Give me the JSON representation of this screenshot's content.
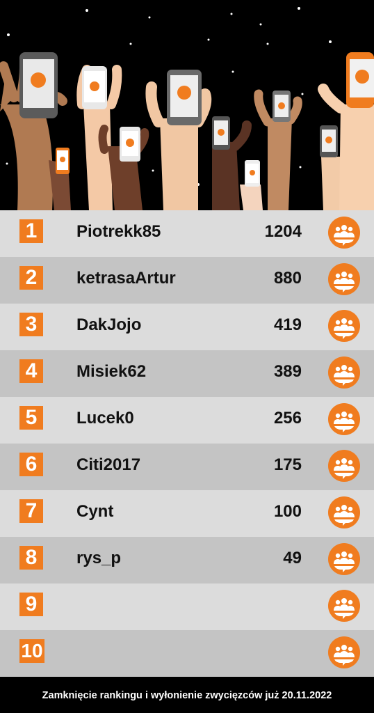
{
  "ranking": [
    {
      "rank": "1",
      "name": "Piotrekk85",
      "score": "1204"
    },
    {
      "rank": "2",
      "name": "ketrasaArtur",
      "score": "880"
    },
    {
      "rank": "3",
      "name": "DakJojo",
      "score": "419"
    },
    {
      "rank": "4",
      "name": "Misiek62",
      "score": "389"
    },
    {
      "rank": "5",
      "name": "Lucek0",
      "score": "256"
    },
    {
      "rank": "6",
      "name": "Citi2017",
      "score": "175"
    },
    {
      "rank": "7",
      "name": "Cynt",
      "score": "100"
    },
    {
      "rank": "8",
      "name": "rys_p",
      "score": "49"
    },
    {
      "rank": "9",
      "name": "",
      "score": ""
    },
    {
      "rank": "10",
      "name": "",
      "score": ""
    }
  ],
  "footer": {
    "text": "Zamknięcie rankingu i wyłonienie zwycięzców już 20.11.2022"
  },
  "icons": {
    "badge": "community-badge-icon",
    "hero": "raised-hands-with-phones-illustration"
  },
  "colors": {
    "accent": "#f07c1f",
    "row_light": "#dcdcdc",
    "row_dark": "#c4c4c4",
    "background": "#000000"
  }
}
